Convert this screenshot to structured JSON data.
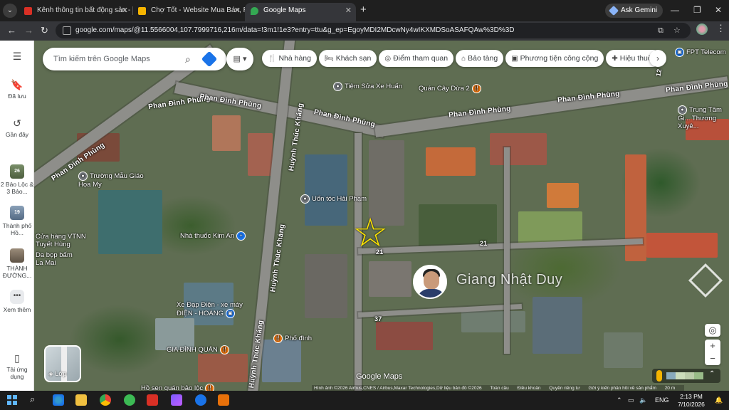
{
  "browser": {
    "tabs": [
      {
        "title": "Kênh thông tin bất động sản - N",
        "color": "#d93025"
      },
      {
        "title": "Chợ Tốt - Website Mua Bán, Rao",
        "color": "#f5b400"
      },
      {
        "title": "Google Maps",
        "color": "#34a853",
        "active": true
      }
    ],
    "ask_gemini": "Ask Gemini",
    "url": "google.com/maps/@11.5566004,107.7999716,216m/data=!3m1!1e3?entry=ttu&g_ep=EgoyMDI2MDcwNy4wIKXMDSoASAFQAw%3D%3D"
  },
  "rail": {
    "saved": "Đã lưu",
    "recent": "Gần đây",
    "recents": [
      {
        "label": "2 Bảo Lộc & 3 Bảo...",
        "badge": "26"
      },
      {
        "label": "Thành phố Hồ...",
        "badge": "19"
      },
      {
        "label": "THÀNH ĐƯỜNG...",
        "badge": ""
      }
    ],
    "more": "Xem thêm",
    "apps": "Tải ứng dụng"
  },
  "search": {
    "placeholder": "Tìm kiếm trên Google Maps"
  },
  "chips": [
    {
      "label": "Nhà hàng",
      "icon": "restaurant-icon"
    },
    {
      "label": "Khách sạn",
      "icon": "hotel-icon"
    },
    {
      "label": "Điểm tham quan",
      "icon": "camera-icon"
    },
    {
      "label": "Bảo tàng",
      "icon": "museum-icon"
    },
    {
      "label": "Phương tiện công cộng",
      "icon": "transit-icon"
    },
    {
      "label": "Hiệu thuốc",
      "icon": "pharmacy-icon"
    }
  ],
  "map": {
    "roads": [
      {
        "name": "Phan Đình Phùng"
      },
      {
        "name": "Phan Đình Phùng"
      },
      {
        "name": "Phan Đình Phùng"
      },
      {
        "name": "Phan Đình Phùng"
      },
      {
        "name": "Huỳnh Thúc Kháng"
      },
      {
        "name": "Huỳnh Thúc Kháng"
      },
      {
        "name": "Huỳnh Thúc Kháng"
      }
    ],
    "alley_numbers": [
      "21",
      "21",
      "37",
      "12"
    ],
    "pois": [
      {
        "name": "Tiệm Sửa Xe Huấn",
        "pin": "gray"
      },
      {
        "name": "Quán Cây Dừa 2",
        "pin": "orange"
      },
      {
        "name": "Trung Tâm Gi... Thương Xuyê...",
        "pin": "gray"
      },
      {
        "name": "Trường Mẫu Giáo Họa My",
        "pin": "gray"
      },
      {
        "name": "Uốn tóc Hải Phạm",
        "pin": "gray"
      },
      {
        "name": "Nhà thuốc Kim An",
        "pin": "blue"
      },
      {
        "name": "Cửa hàng VTNN Tuyết Hùng",
        "pin": "blue"
      },
      {
        "name": "Da bọp bấm La Mai",
        "pin": "gray"
      },
      {
        "name": "Xe Đạp Điện - xe máy ĐIỆN - HOÀNG",
        "pin": "blue"
      },
      {
        "name": "Phố đình",
        "pin": "orange"
      },
      {
        "name": "GIA ĐÌNH QUÁN",
        "pin": "orange"
      },
      {
        "name": "Hồ sen quán bảo lộc",
        "pin": "orange"
      },
      {
        "name": "FPT Telecom",
        "pin": "blue"
      }
    ],
    "watermark_name": "Giang Nhật Duy",
    "layer_label": "Lớp",
    "logo": "Google Maps",
    "attribution": [
      "Hình ảnh ©2026 Airbus,CNES / Airbus,Maxar Technologies,Dữ liệu bản đồ ©2026",
      "Toàn cầu",
      "Điều khoản",
      "Quyền riêng tư",
      "Gửi ý kiến phản hồi về sản phẩm",
      "20 m"
    ]
  },
  "taskbar": {
    "lang": "ENG",
    "time": "2:13 PM",
    "date": "7/10/2026"
  }
}
